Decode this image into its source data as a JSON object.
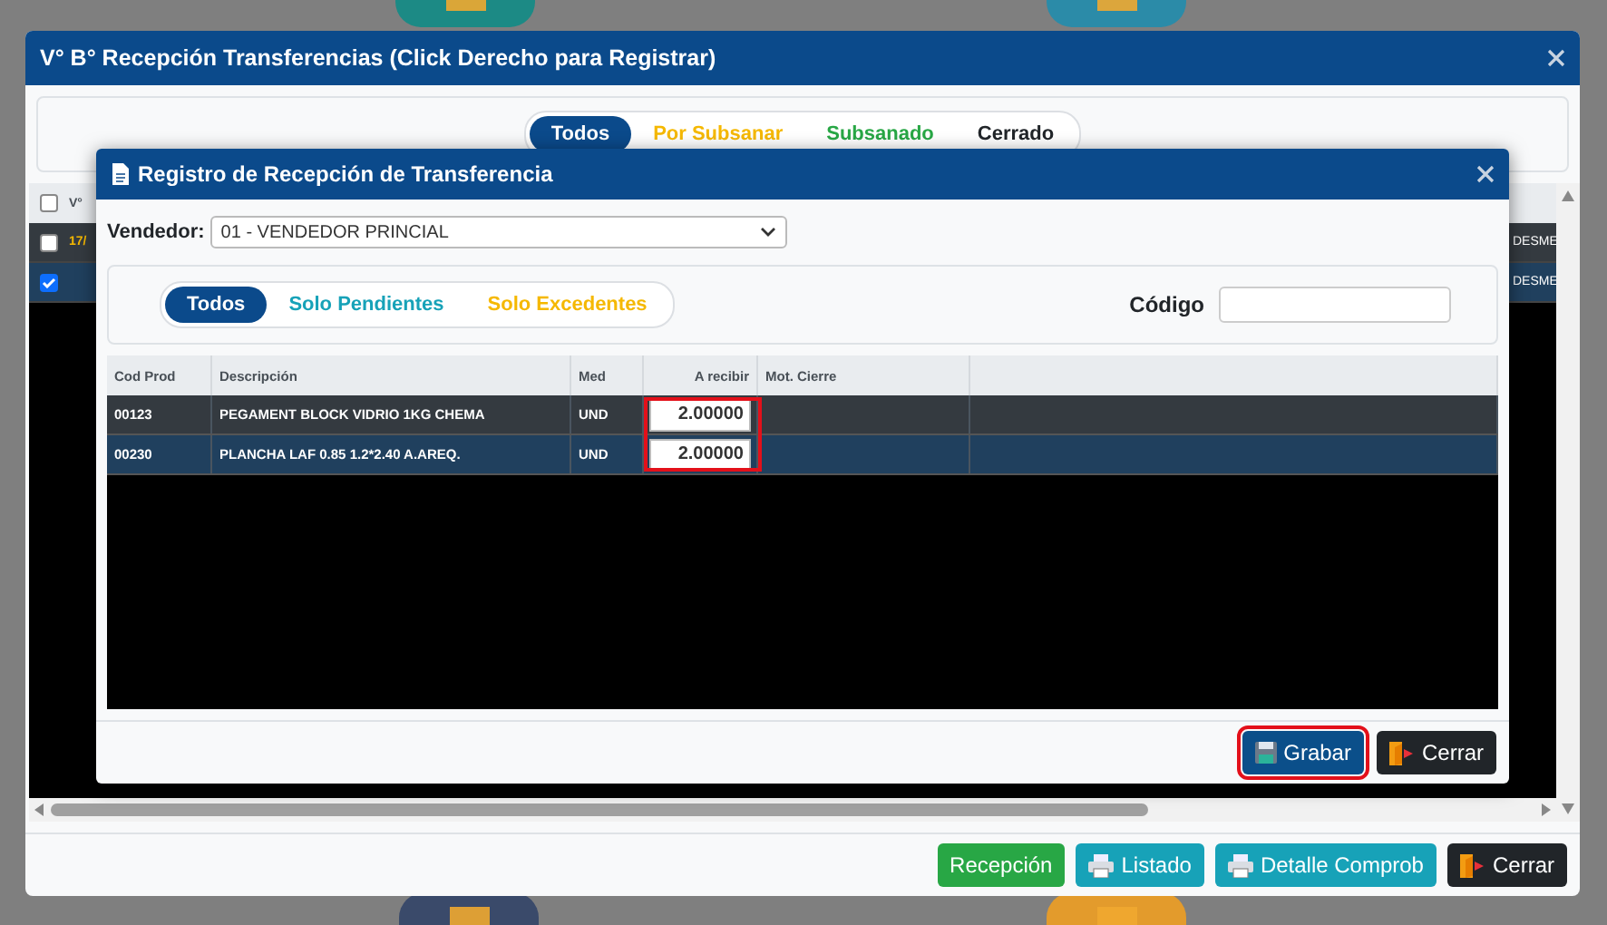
{
  "window": {
    "title": "V° B° Recepción Transferencias (Click Derecho para Registrar)"
  },
  "filter_tabs": [
    {
      "label": "Todos",
      "selected": true,
      "color": "#0b4a8b"
    },
    {
      "label": "Por Subsanar",
      "selected": false,
      "color": "#f5b800"
    },
    {
      "label": "Subsanado",
      "selected": false,
      "color": "#28a745"
    },
    {
      "label": "Cerrado",
      "selected": false,
      "color": "#212529"
    }
  ],
  "grid": {
    "all_checked": false,
    "columns": [
      "V°"
    ],
    "rows": [
      {
        "checked": false,
        "selected": false,
        "column_1": "17/",
        "column_last": "DESME"
      },
      {
        "checked": true,
        "selected": true,
        "column_last": "DESME"
      }
    ]
  },
  "footer_buttons": [
    {
      "label": "Recepción",
      "kind": "success"
    },
    {
      "label": "Listado",
      "kind": "print"
    },
    {
      "label": "Detalle Comprob",
      "kind": "print"
    },
    {
      "label": "Cerrar",
      "kind": "exit"
    }
  ],
  "dialog": {
    "title": "Registro de Recepción de Transferencia",
    "vendor_label": "Vendedor:",
    "vendor_value": "01 - VENDEDOR PRINCIAL",
    "tabs": [
      {
        "label": "Todos",
        "selected": true,
        "color": "#0b4a8b"
      },
      {
        "label": "Solo Pendientes",
        "selected": false,
        "color": "#17a2b8"
      },
      {
        "label": "Solo Excedentes",
        "selected": false,
        "color": "#f5b800"
      }
    ],
    "code_label": "Código",
    "table": {
      "columns": [
        "Cod Prod",
        "Descripción",
        "Med",
        "A recibir",
        "Mot. Cierre"
      ],
      "a_recibir_highlighted": true,
      "rows": [
        {
          "cod_prod": "00123",
          "descripcion": "PEGAMENT BLOCK VIDRIO 1KG CHEMA",
          "med": "UND",
          "a_recibir": "2.00000",
          "selected": false
        },
        {
          "cod_prod": "00230",
          "descripcion": "PLANCHA LAF 0.85 1.2*2.40 A.AREQ.",
          "med": "UND",
          "a_recibir": "2.00000",
          "selected": true
        }
      ]
    },
    "buttons": [
      {
        "label": "Grabar",
        "kind": "save",
        "highlighted": true
      },
      {
        "label": "Cerrar",
        "kind": "exit",
        "highlighted": false
      }
    ]
  }
}
